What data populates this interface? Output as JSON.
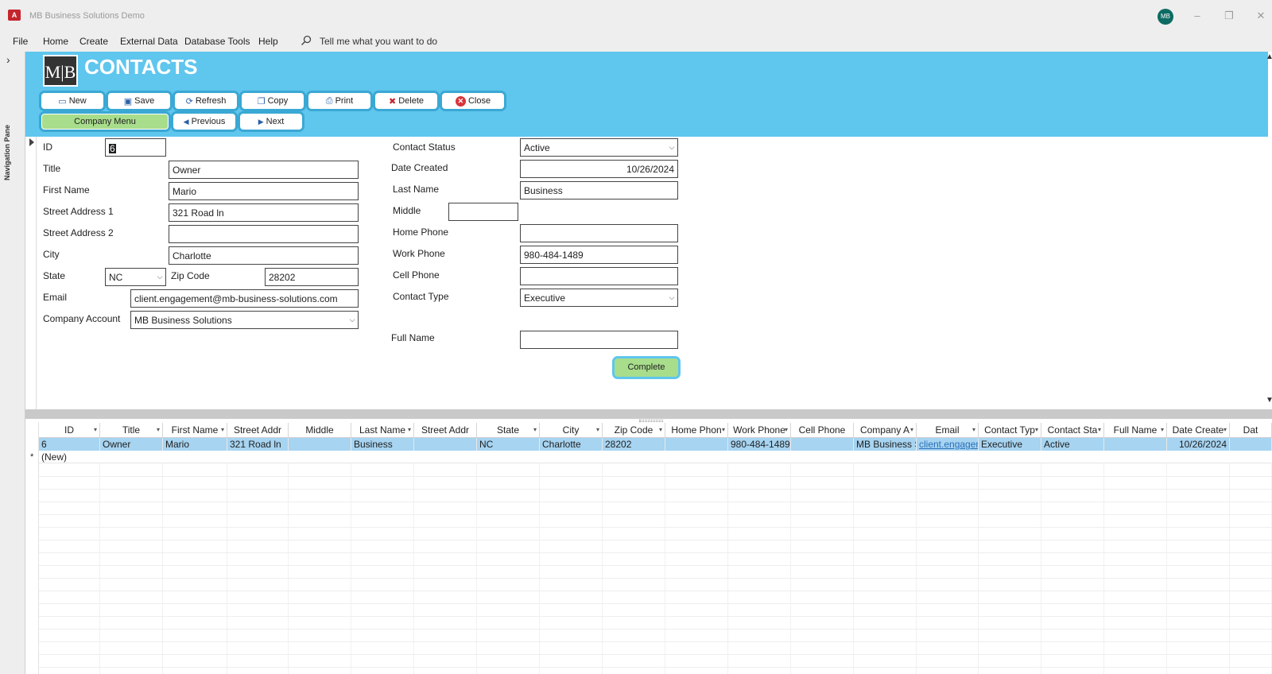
{
  "window": {
    "app_icon": "A",
    "title": "MB Business Solutions Demo",
    "avatar_initials": "MB",
    "minimize": "–",
    "restore": "❐",
    "close": "✕"
  },
  "menu": {
    "items": [
      "File",
      "Home",
      "Create",
      "External Data",
      "Database Tools",
      "Help"
    ],
    "tell_me": "Tell me what you want to do"
  },
  "nav_pane": {
    "label": "Navigation Pane",
    "chevron": "›"
  },
  "header": {
    "logo": "M|B",
    "title": "CONTACTS",
    "buttons": {
      "new": "New",
      "save": "Save",
      "refresh": "Refresh",
      "copy": "Copy",
      "print": "Print",
      "delete": "Delete",
      "close": "Close"
    },
    "nav_buttons": {
      "company_menu": "Company Menu",
      "previous": "Previous",
      "next": "Next"
    }
  },
  "form": {
    "labels": {
      "id": "ID",
      "title": "Title",
      "first_name": "First Name",
      "street1": "Street Address 1",
      "street2": "Street Address 2",
      "city": "City",
      "state": "State",
      "zip": "Zip Code",
      "email": "Email",
      "company": "Company Account",
      "contact_status": "Contact Status",
      "date_created": "Date Created",
      "last_name": "Last Name",
      "middle": "Middle",
      "home_phone": "Home Phone",
      "work_phone": "Work Phone",
      "cell_phone": "Cell Phone",
      "contact_type": "Contact Type",
      "full_name": "Full Name"
    },
    "values": {
      "id": "6",
      "title": "Owner",
      "first_name": "Mario",
      "street1": "321 Road ln",
      "street2": "",
      "city": "Charlotte",
      "state": "NC",
      "zip": "28202",
      "email": "client.engagement@mb-business-solutions.com",
      "company": "MB Business Solutions",
      "contact_status": "Active",
      "date_created": "10/26/2024",
      "last_name": "Business",
      "middle": "",
      "home_phone": "",
      "work_phone": "980-484-1489",
      "cell_phone": "",
      "contact_type": "Executive",
      "full_name": ""
    },
    "complete_button": "Complete"
  },
  "datasheet": {
    "columns": [
      "ID",
      "Title",
      "First Name",
      "Street Addr",
      "Middle",
      "Last Name",
      "Street Addr",
      "State",
      "City",
      "Zip Code",
      "Home Phon",
      "Work Phone",
      "Cell Phone",
      "Company A",
      "Email",
      "Contact Typ",
      "Contact Sta",
      "Full Name",
      "Date Create",
      "Dat"
    ],
    "row": [
      "6",
      "Owner",
      "Mario",
      "321 Road ln",
      "",
      "Business",
      "",
      "NC",
      "Charlotte",
      "28202",
      "",
      "980-484-1489",
      "",
      "MB Business S",
      "client.engager",
      "Executive",
      "Active",
      "",
      "10/26/2024",
      ""
    ],
    "new_row_marker": "*",
    "new_row_label": "(New)"
  }
}
